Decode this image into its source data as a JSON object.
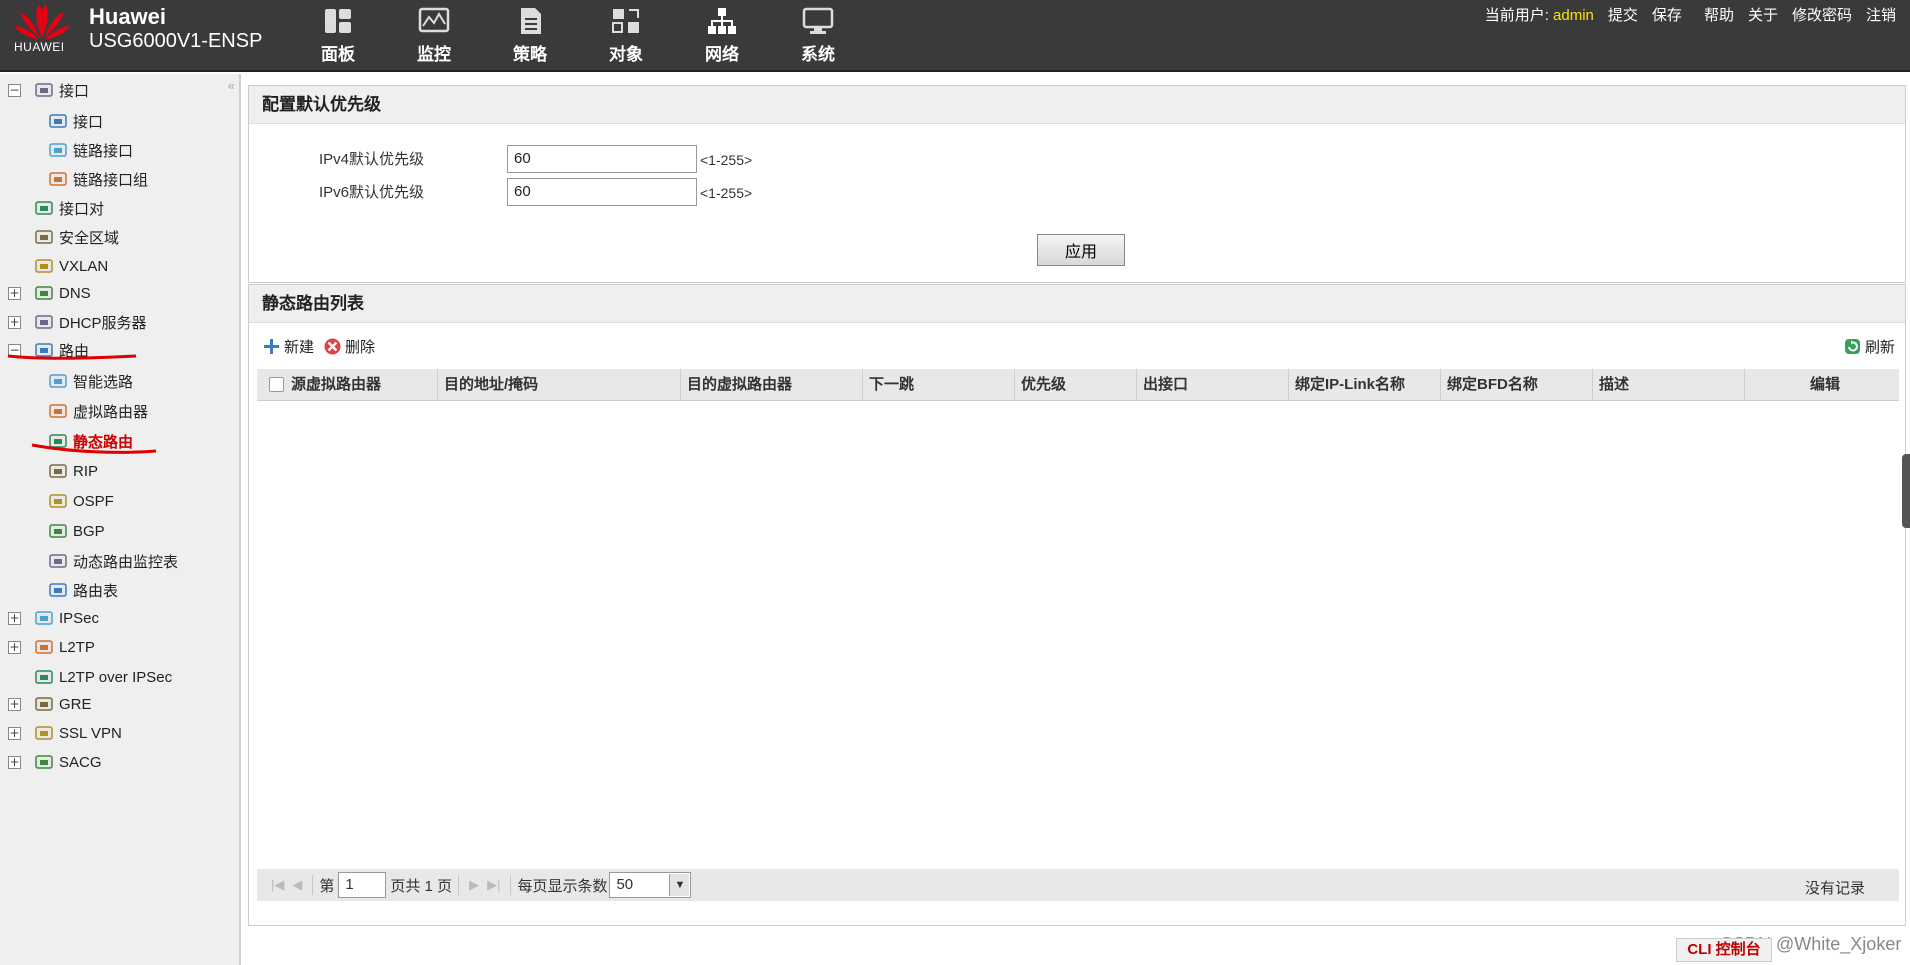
{
  "header": {
    "brand": "Huawei",
    "model": "USG6000V1-ENSP",
    "logo_text": "HUAWEI",
    "nav": [
      {
        "label": "面板",
        "icon": "dashboard-icon"
      },
      {
        "label": "监控",
        "icon": "monitor-icon"
      },
      {
        "label": "策略",
        "icon": "policy-icon"
      },
      {
        "label": "对象",
        "icon": "object-icon"
      },
      {
        "label": "网络",
        "icon": "network-icon"
      },
      {
        "label": "系统",
        "icon": "system-icon"
      }
    ],
    "user_prefix": "当前用户:",
    "user": "admin",
    "actions": [
      "提交",
      "保存",
      "帮助",
      "关于",
      "修改密码",
      "注销"
    ]
  },
  "sidebar": {
    "collapse": "«",
    "items": [
      {
        "label": "接口",
        "icon": "interface-icon",
        "expander": "−"
      },
      {
        "label": "接口",
        "icon": "interface-icon"
      },
      {
        "label": "链路接口",
        "icon": "link-interface-icon"
      },
      {
        "label": "链路接口组",
        "icon": "link-group-icon"
      },
      {
        "label": "接口对",
        "icon": "interface-pair-icon"
      },
      {
        "label": "安全区域",
        "icon": "security-zone-icon"
      },
      {
        "label": "VXLAN",
        "icon": "vxlan-icon"
      },
      {
        "label": "DNS",
        "icon": "dns-icon",
        "expander": "+"
      },
      {
        "label": "DHCP服务器",
        "icon": "dhcp-icon",
        "expander": "+"
      },
      {
        "label": "路由",
        "icon": "route-icon",
        "expander": "−"
      },
      {
        "label": "智能选路",
        "icon": "smart-route-icon"
      },
      {
        "label": "虚拟路由器",
        "icon": "virtual-router-icon"
      },
      {
        "label": "静态路由",
        "icon": "static-route-icon",
        "selected": true
      },
      {
        "label": "RIP",
        "icon": "rip-icon"
      },
      {
        "label": "OSPF",
        "icon": "ospf-icon"
      },
      {
        "label": "BGP",
        "icon": "bgp-icon"
      },
      {
        "label": "动态路由监控表",
        "icon": "route-monitor-icon"
      },
      {
        "label": "路由表",
        "icon": "route-table-icon"
      },
      {
        "label": "IPSec",
        "icon": "ipsec-icon",
        "expander": "+"
      },
      {
        "label": "L2TP",
        "icon": "l2tp-icon",
        "expander": "+"
      },
      {
        "label": "L2TP over IPSec",
        "icon": "l2tp-ipsec-icon"
      },
      {
        "label": "GRE",
        "icon": "gre-icon",
        "expander": "+"
      },
      {
        "label": "SSL VPN",
        "icon": "sslvpn-icon",
        "expander": "+"
      },
      {
        "label": "SACG",
        "icon": "sacg-icon",
        "expander": "+"
      }
    ]
  },
  "priority_panel": {
    "title": "配置默认优先级",
    "ipv4_label": "IPv4默认优先级",
    "ipv4_value": "60",
    "ipv4_hint": "<1-255>",
    "ipv6_label": "IPv6默认优先级",
    "ipv6_value": "60",
    "ipv6_hint": "<1-255>",
    "apply": "应用"
  },
  "route_panel": {
    "title": "静态路由列表",
    "new": "新建",
    "delete": "删除",
    "refresh": "刷新",
    "columns": [
      "源虚拟路由器",
      "目的地址/掩码",
      "目的虚拟路由器",
      "下一跳",
      "优先级",
      "出接口",
      "绑定IP-Link名称",
      "绑定BFD名称",
      "描述",
      "编辑"
    ],
    "pager": {
      "page_prefix": "第",
      "page": "1",
      "page_suffix": "页共 1 页",
      "page_size_label": "每页显示条数",
      "page_size": "50",
      "no_records": "没有记录"
    }
  },
  "footer": {
    "cli": "CLI 控制台",
    "watermark": "CSDN @White_Xjoker"
  },
  "colors": {
    "header_bg": "#3a3a3a",
    "user_highlight": "#ffe000",
    "selected_text": "#cc0000",
    "annotation": "#e00000"
  }
}
